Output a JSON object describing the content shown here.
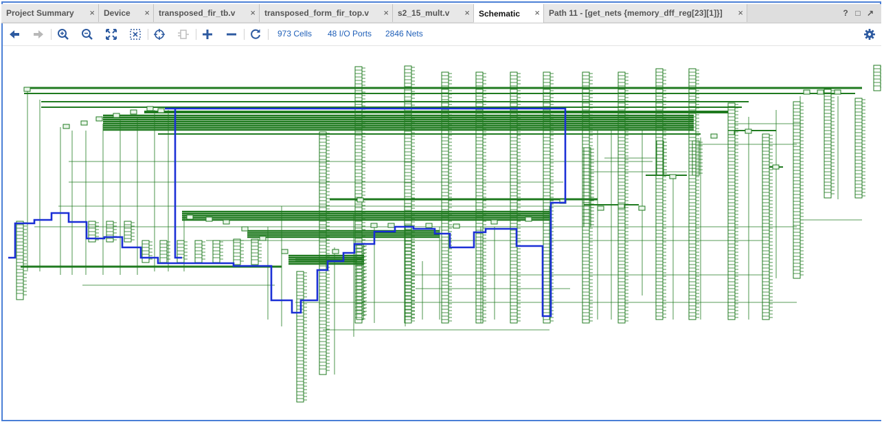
{
  "tabs": [
    {
      "label": "Project Summary",
      "active": false
    },
    {
      "label": "Device",
      "active": false
    },
    {
      "label": "transposed_fir_tb.v",
      "active": false
    },
    {
      "label": "transposed_form_fir_top.v",
      "active": false
    },
    {
      "label": "s2_15_mult.v",
      "active": false
    },
    {
      "label": "Schematic",
      "active": true
    },
    {
      "label": "Path 11 - [get_nets {memory_dff_reg[23][1]}]",
      "active": false
    }
  ],
  "window_controls": {
    "help": "?",
    "restore": "□",
    "float": "↗"
  },
  "toolbar": {
    "buttons": [
      {
        "name": "back-button",
        "icon": "arrow-left-icon",
        "enabled": true
      },
      {
        "name": "forward-button",
        "icon": "arrow-right-icon",
        "enabled": false
      },
      {
        "name": "zoom-in-button",
        "icon": "zoom-in-icon",
        "enabled": true
      },
      {
        "name": "zoom-out-button",
        "icon": "zoom-out-icon",
        "enabled": true
      },
      {
        "name": "zoom-fit-button",
        "icon": "fit-all-icon",
        "enabled": true
      },
      {
        "name": "zoom-area-button",
        "icon": "fit-selection-icon",
        "enabled": true
      },
      {
        "name": "find-button",
        "icon": "crosshair-icon",
        "enabled": true
      },
      {
        "name": "regenerate-button",
        "icon": "cell-icon",
        "enabled": false
      },
      {
        "name": "expand-button",
        "icon": "plus-icon",
        "enabled": true
      },
      {
        "name": "collapse-button",
        "icon": "minus-icon",
        "enabled": true
      },
      {
        "name": "refresh-button",
        "icon": "refresh-icon",
        "enabled": true
      }
    ],
    "stats": {
      "cells": "973 Cells",
      "ports": "48 I/O Ports",
      "nets": "2846 Nets"
    },
    "settings_icon": "gear-icon"
  },
  "schematic": {
    "net_color": "#1f7a1f",
    "highlight_color": "#1a2fd6",
    "highlighted_net": "memory_dff_reg[23][1]"
  },
  "colors": {
    "accent": "#1f5fb8",
    "frame_border": "#4a7fd6",
    "tab_bg": "#dedede"
  }
}
